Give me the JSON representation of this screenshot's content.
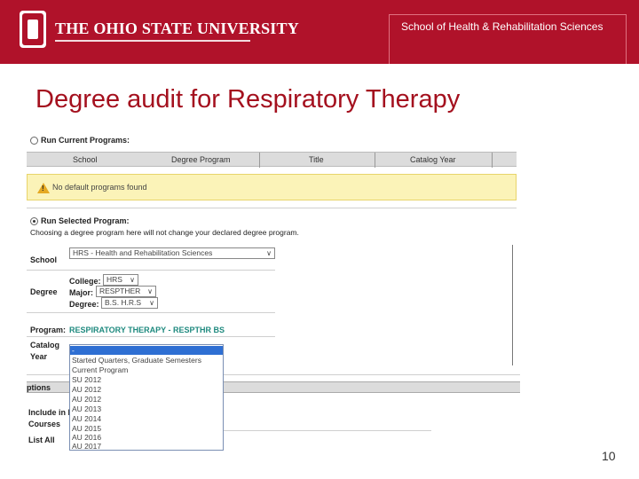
{
  "header": {
    "university_name": "THE OHIO STATE UNIVERSITY",
    "school_name": "School of Health & Rehabilitation Sciences",
    "brand_color": "#b0122a"
  },
  "slide": {
    "title": "Degree audit for Respiratory Therapy",
    "page_number": "10"
  },
  "audit": {
    "run_current_label": "Run Current Programs:",
    "table_columns": [
      "School",
      "Degree Program",
      "Title",
      "Catalog Year"
    ],
    "warning_text": "No default programs found",
    "run_selected_label": "Run Selected Program:",
    "run_selected_note": "Choosing a degree program here will not change your declared degree program.",
    "school_label": "School",
    "school_value": "HRS - Health and Rehabilitation Sciences",
    "degree_label": "Degree",
    "college_label": "College:",
    "college_value": "HRS",
    "major_label": "Major:",
    "major_value": "RESPTHER",
    "degree_sub_label": "Degree:",
    "degree_value": "B.S. H.R.S",
    "program_label": "Program:",
    "program_value": "RESPIRATORY THERAPY - RESPTHR BS",
    "catalog_label": "Catalog",
    "year_label": "Year",
    "catalog_options": [
      "-",
      "Started Quarters, Graduate Semesters",
      "Current Program",
      "SU 2012",
      "AU 2012",
      "AU 2012",
      "AU 2013",
      "AU 2014",
      "AU 2015",
      "AU 2016",
      "AU 2017"
    ],
    "options_label": "ptions",
    "include_label": "Include in F",
    "courses_label": "Courses",
    "list_all_label": "List All"
  }
}
